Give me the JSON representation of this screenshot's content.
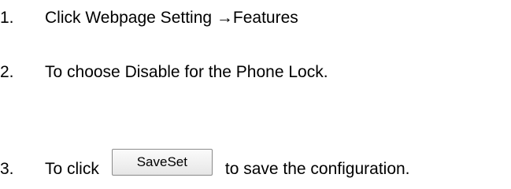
{
  "steps": [
    {
      "number": "1.",
      "text": "Click Webpage Setting →Features"
    },
    {
      "number": "2.",
      "text": "To choose Disable for the Phone Lock."
    },
    {
      "number": "3.",
      "text_before": "To click",
      "button_label": "SaveSet",
      "text_after": "to save the configuration."
    }
  ]
}
